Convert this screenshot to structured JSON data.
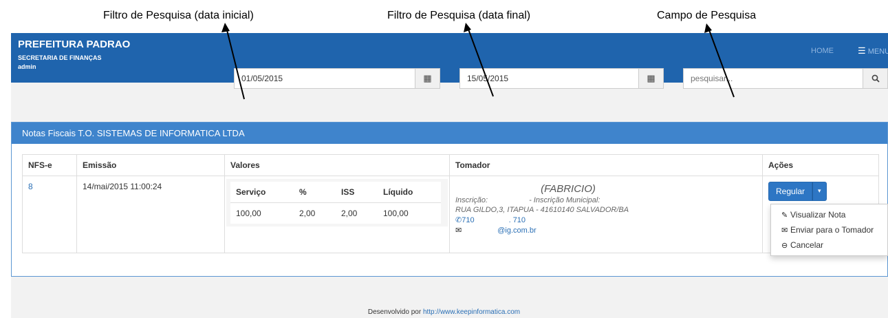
{
  "annotations": {
    "filter_start": "Filtro de Pesquisa (data inicial)",
    "filter_end": "Filtro de Pesquisa (data final)",
    "search_field": "Campo de Pesquisa"
  },
  "navbar": {
    "brand": "PREFEITURA PADRAO",
    "subtitle": "SECRETARIA DE FINANÇAS",
    "user": "admin",
    "home": "HOME",
    "menu": "MENU",
    "menu_icon": "bars-icon"
  },
  "filters": {
    "start_date": "01/05/2015",
    "end_date": "15/05/2015",
    "search_placeholder": "pesquisar...",
    "calendar_icon": "calendar-icon",
    "search_icon": "search-icon"
  },
  "panel": {
    "title": "Notas Fiscais T.O. SISTEMAS DE INFORMATICA LTDA"
  },
  "table": {
    "headers": [
      "NFS-e",
      "Emissão",
      "Valores",
      "Tomador",
      "Ações"
    ],
    "row": {
      "nfse": "8",
      "emissao": "14/mai/2015 11:00:24",
      "valores": {
        "headers": [
          "Serviço",
          "%",
          "ISS",
          "Líquido"
        ],
        "values": [
          "100,00",
          "2,00",
          "2,00",
          "100,00"
        ]
      },
      "tomador": {
        "name": "(FABRICIO)",
        "inscricao": "Inscrição:",
        "inscricao_municipal": "- Inscrição Municipal:",
        "address": "RUA GILDO,3, ITAPUA - 41610140 SALVADOR/BA",
        "phone1": "710",
        "phone2": ". 710",
        "email": "@ig.com.br"
      },
      "acoes": {
        "button": "Regular",
        "menu": [
          "Visualizar Nota",
          "Enviar para o Tomador",
          "Cancelar"
        ]
      }
    }
  },
  "footer": {
    "text": "Desenvolvido por",
    "link": "http://www.keepinformatica.com"
  }
}
